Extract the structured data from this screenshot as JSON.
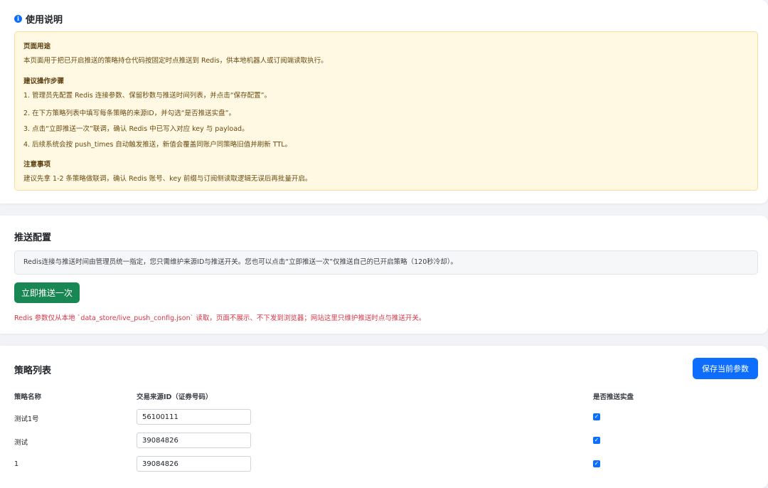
{
  "guide": {
    "title": "使用说明",
    "purpose_heading": "页面用途",
    "purpose_text": "本页面用于把已开启推送的策略持仓代码按固定时点推送到 Redis，供本地机器人或订阅端读取执行。",
    "steps_heading": "建议操作步骤",
    "steps": [
      "1. 管理员先配置 Redis 连接参数、保留秒数与推送时间列表，并点击“保存配置”。",
      "2. 在下方策略列表中填写每条策略的来源ID，并勾选“是否推送实盘”。",
      "3. 点击“立即推送一次”联调，确认 Redis 中已写入对应 key 与 payload。",
      "4. 后续系统会按 push_times 自动触发推送，新值会覆盖同账户同策略旧值并刷新 TTL。"
    ],
    "notes_heading": "注意事项",
    "notes_text": "建议先拿 1-2 条策略做联调，确认 Redis 账号、key 前缀与订阅侧读取逻辑无误后再批量开启。"
  },
  "push_config": {
    "title": "推送配置",
    "info_text": "Redis连接与推送时间由管理员统一指定，您只需维护来源ID与推送开关。您也可以点击“立即推送一次”仅推送自己的已开启策略（120秒冷却）。",
    "push_now_label": "立即推送一次",
    "redis_note": "Redis 参数仅从本地 `data_store/live_push_config.json` 读取，页面不展示、不下发到浏览器；网站这里只维护推送时点与推送开关。"
  },
  "strategy_list": {
    "title": "策略列表",
    "save_label": "保存当前参数",
    "columns": {
      "name": "策略名称",
      "source_id": "交易来源ID（证券号码）",
      "push_live": "是否推送实盘"
    },
    "rows": [
      {
        "name": "测试1号",
        "source_id": "56100111",
        "push_live": true
      },
      {
        "name": "测试",
        "source_id": "39084826",
        "push_live": true
      },
      {
        "name": "1",
        "source_id": "39084826",
        "push_live": true
      }
    ]
  },
  "colors": {
    "primary": "#0d6efd",
    "success": "#198754",
    "danger": "#dc3545",
    "warning_bg": "#fff9e3"
  },
  "icons": {
    "guide_title": "info-circle-icon",
    "checkbox": "checkmark-icon"
  }
}
